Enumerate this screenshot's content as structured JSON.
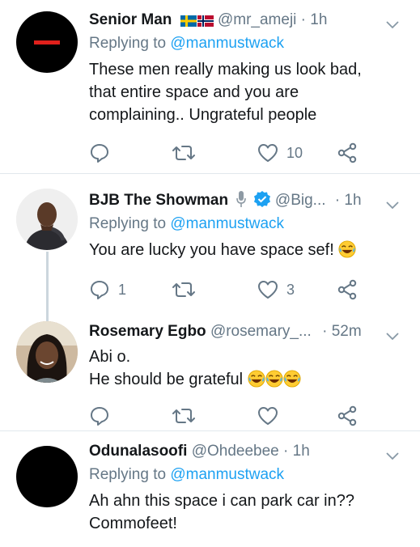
{
  "colors": {
    "accent": "#1da1f2",
    "muted": "#657786",
    "text": "#14171a",
    "border": "#e1e8ed"
  },
  "tweets": [
    {
      "name": "Senior Man",
      "handle": "@mr_ameji",
      "time": "· 1h",
      "reply_prefix": "Replying to ",
      "reply_to": "@manmustwack",
      "lines": [
        "These men really making us look bad,",
        "that entire space and you are",
        "complaining.. Ungrateful people"
      ],
      "reply_count": "",
      "like_count": "10"
    },
    {
      "name": "BJB The Showman",
      "handle": "@Big...",
      "time": "· 1h",
      "reply_prefix": "Replying to ",
      "reply_to": "@manmustwack",
      "lines": [
        "You are lucky you have space sef!"
      ],
      "reply_count": "1",
      "like_count": "3"
    },
    {
      "name": "Rosemary Egbo",
      "handle": "@rosemary_...",
      "time": "· 52m",
      "lines": [
        "Abi o.",
        "He should be grateful"
      ],
      "reply_count": "",
      "like_count": ""
    },
    {
      "name": "Odunalasoofi",
      "handle": "@Ohdeebee",
      "time": "· 1h",
      "reply_prefix": "Replying to ",
      "reply_to": "@manmustwack",
      "lines": [
        "Ah ahn this space i can park car in??",
        "Commofeet!"
      ]
    }
  ]
}
